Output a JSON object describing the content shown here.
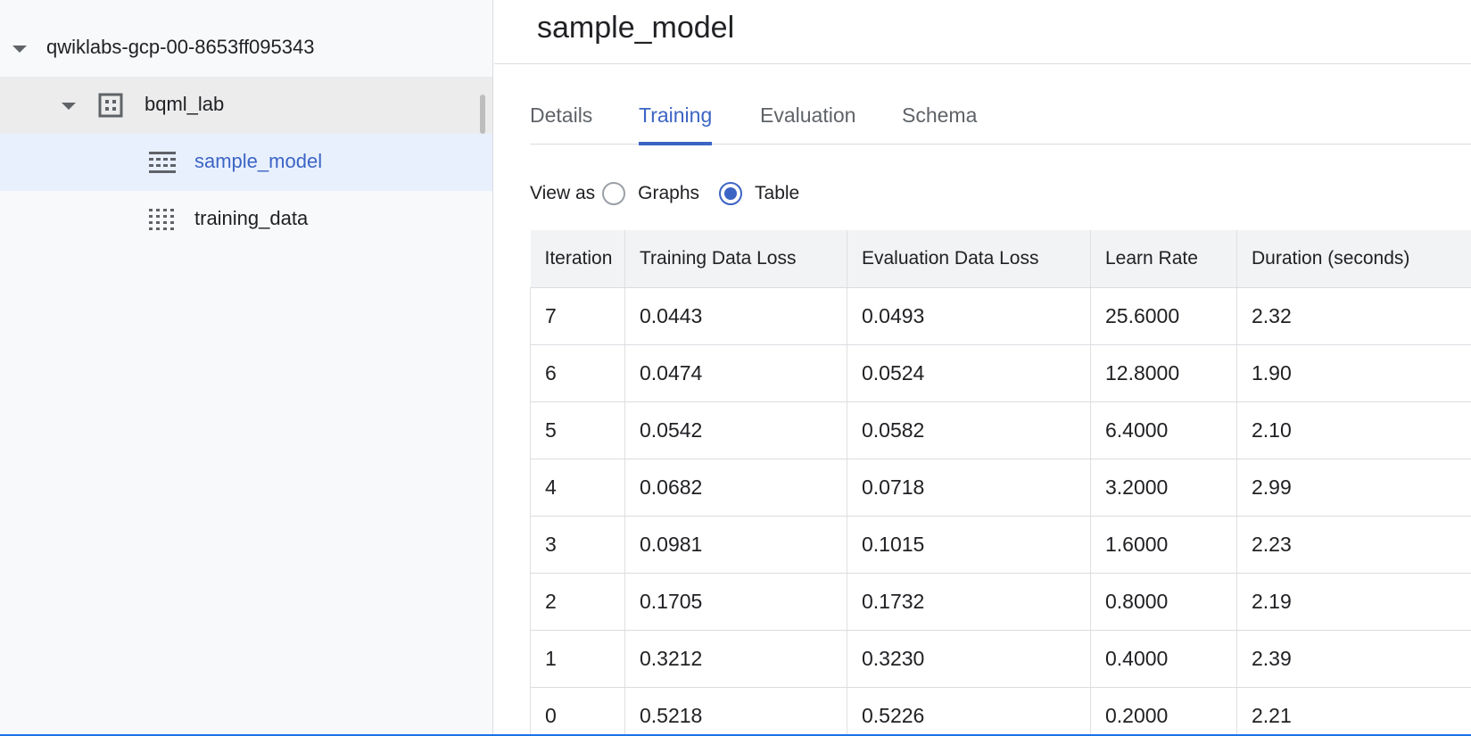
{
  "explorer": {
    "project": "qwiklabs-gcp-00-8653ff095343",
    "dataset": "bqml_lab",
    "items": [
      {
        "label": "sample_model",
        "icon": "model-grid-icon"
      },
      {
        "label": "training_data",
        "icon": "table-grid-icon"
      }
    ]
  },
  "page": {
    "title": "sample_model"
  },
  "tabs": [
    {
      "label": "Details"
    },
    {
      "label": "Training"
    },
    {
      "label": "Evaluation"
    },
    {
      "label": "Schema"
    }
  ],
  "active_tab": "Training",
  "view_as": {
    "label": "View as",
    "options": [
      "Graphs",
      "Table"
    ],
    "selected": "Table"
  },
  "table": {
    "headers": [
      "Iteration",
      "Training Data Loss",
      "Evaluation Data Loss",
      "Learn Rate",
      "Duration (seconds)"
    ],
    "rows": [
      [
        "7",
        "0.0443",
        "0.0493",
        "25.6000",
        "2.32"
      ],
      [
        "6",
        "0.0474",
        "0.0524",
        "12.8000",
        "1.90"
      ],
      [
        "5",
        "0.0542",
        "0.0582",
        "6.4000",
        "2.10"
      ],
      [
        "4",
        "0.0682",
        "0.0718",
        "3.2000",
        "2.99"
      ],
      [
        "3",
        "0.0981",
        "0.1015",
        "1.6000",
        "2.23"
      ],
      [
        "2",
        "0.1705",
        "0.1732",
        "0.8000",
        "2.19"
      ],
      [
        "1",
        "0.3212",
        "0.3230",
        "0.4000",
        "2.39"
      ],
      [
        "0",
        "0.5218",
        "0.5226",
        "0.2000",
        "2.21"
      ]
    ]
  },
  "colors": {
    "accent": "#3c64c4",
    "selected_row_bg": "#e8f0fe",
    "dataset_row_bg": "#ececec"
  }
}
